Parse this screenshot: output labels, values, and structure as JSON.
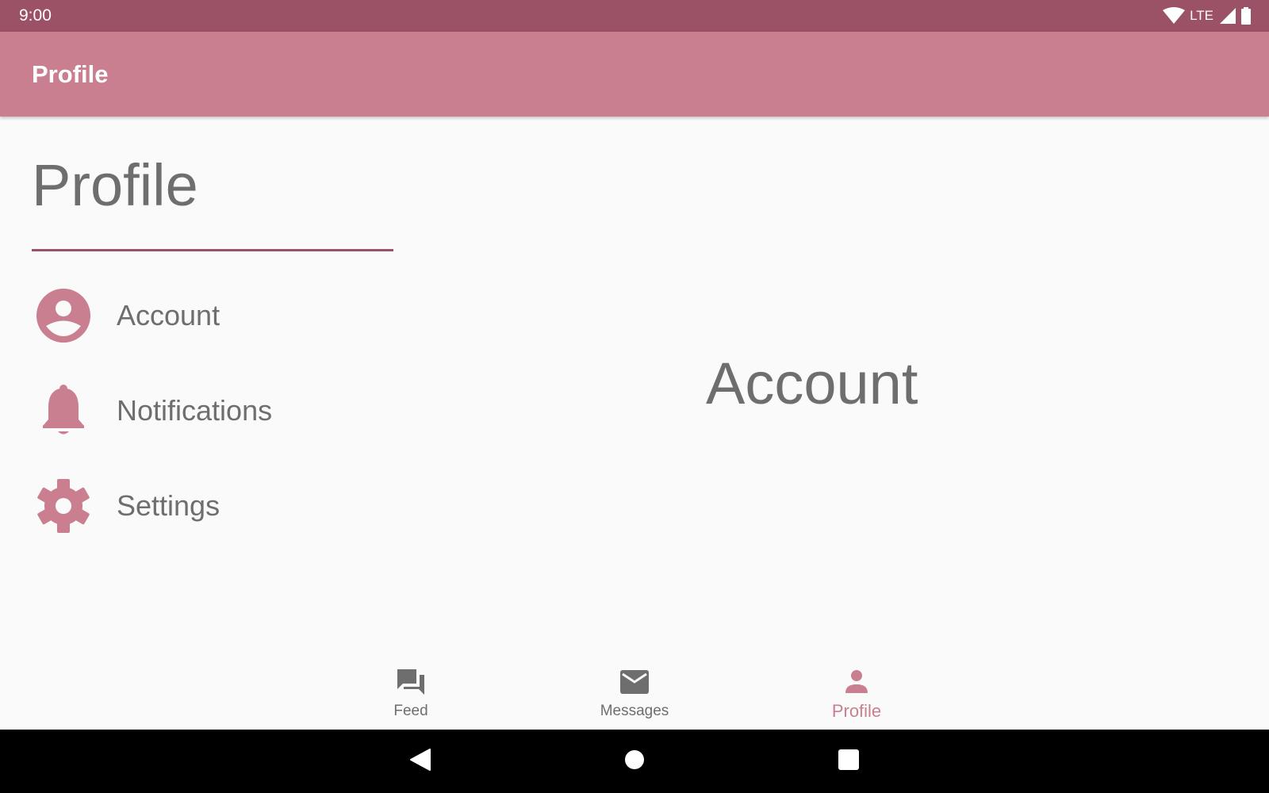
{
  "status_bar": {
    "time": "9:00",
    "network": "LTE",
    "icons": [
      "wifi-icon",
      "cell-signal-icon",
      "battery-icon"
    ]
  },
  "app_bar": {
    "title": "Profile"
  },
  "master": {
    "title": "Profile",
    "items": [
      {
        "label": "Account",
        "icon": "account-circle-icon"
      },
      {
        "label": "Notifications",
        "icon": "bell-icon"
      },
      {
        "label": "Settings",
        "icon": "gear-icon"
      }
    ]
  },
  "detail": {
    "title": "Account"
  },
  "bottom_nav": {
    "items": [
      {
        "label": "Feed",
        "icon": "forum-icon",
        "active": false
      },
      {
        "label": "Messages",
        "icon": "mail-icon",
        "active": false
      },
      {
        "label": "Profile",
        "icon": "person-icon",
        "active": true
      }
    ]
  },
  "system_nav": {
    "icons": [
      "back-icon",
      "home-icon",
      "recents-icon"
    ]
  },
  "colors": {
    "status_bar": "#9b5166",
    "app_bar": "#c97f8f",
    "accent": "#c97f8f",
    "divider": "#9b5166",
    "text_gray": "#6e6e6e",
    "background": "#fafafa"
  }
}
